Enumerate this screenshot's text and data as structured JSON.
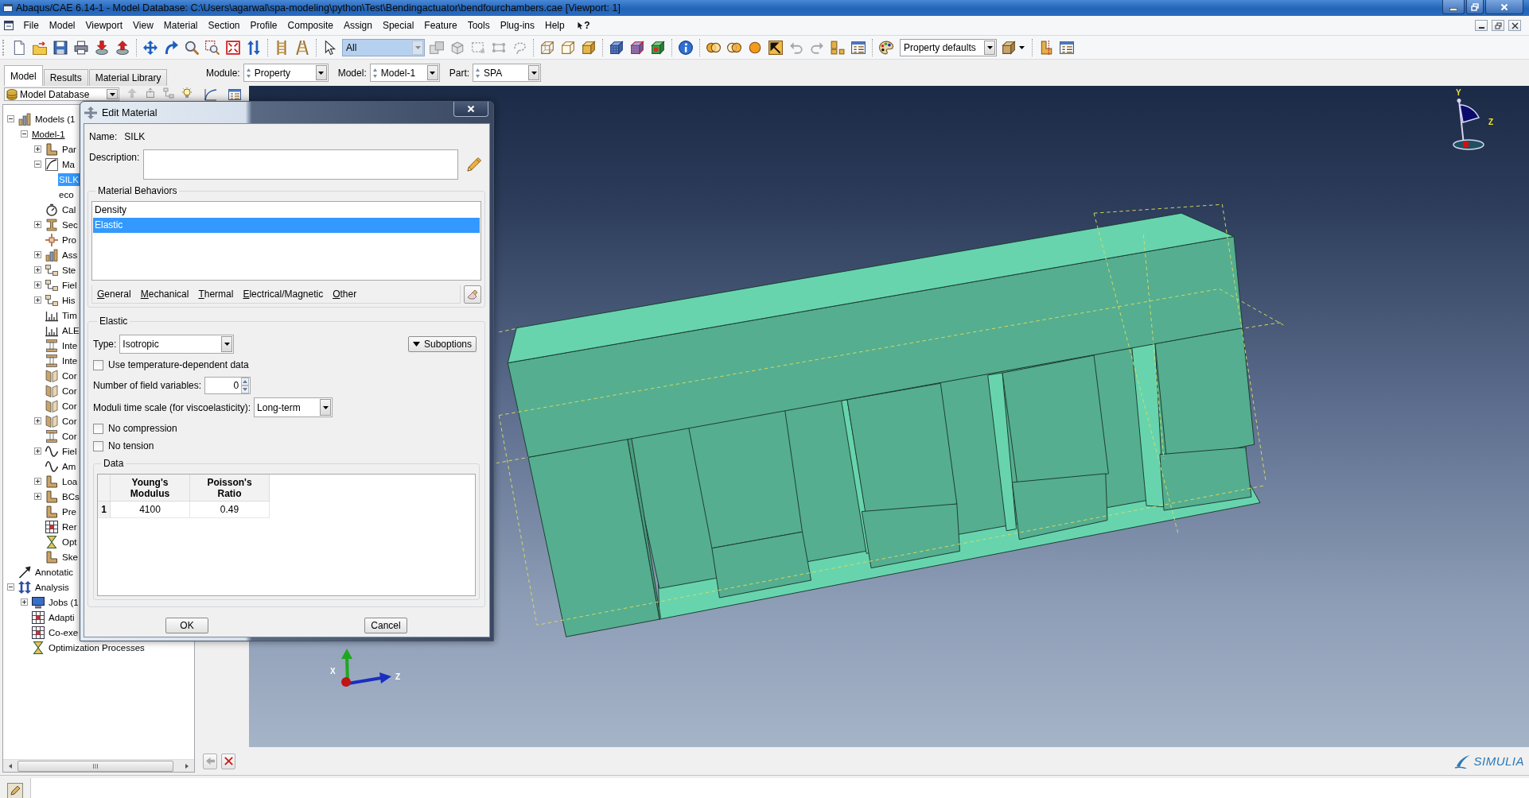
{
  "window": {
    "title": "Abaqus/CAE 6.14-1 - Model Database: C:\\Users\\agarwal\\spa-modeling\\python\\Test\\Bendingactuator\\bendfourchambers.cae [Viewport: 1]"
  },
  "menu_bar": {
    "items": [
      "File",
      "Model",
      "Viewport",
      "View",
      "Material",
      "Section",
      "Profile",
      "Composite",
      "Assign",
      "Special",
      "Feature",
      "Tools",
      "Plug-ins",
      "Help"
    ],
    "whats_this": "?"
  },
  "toolbar": {
    "selection_filter": "All",
    "color_code": "Property defaults"
  },
  "context_bar": [
    {
      "label": "Module:",
      "value": "Property"
    },
    {
      "label": "Model:",
      "value": "Model-1"
    },
    {
      "label": "Part:",
      "value": "SPA"
    }
  ],
  "model_tree": {
    "tabs": [
      {
        "label": "Model",
        "selected": true
      },
      {
        "label": "Results",
        "selected": false
      },
      {
        "label": "Material Library",
        "selected": false
      }
    ],
    "source": "Model Database",
    "items": [
      {
        "label": "Models (1",
        "kind": "models",
        "expanded": true,
        "selected": false,
        "children": [
          {
            "label": "Model-1",
            "expanded": true,
            "selected": false,
            "current": true,
            "children": [
              {
                "label": "Par",
                "kind": "parts",
                "expanded": false,
                "selected": false
              },
              {
                "label": "Ma",
                "kind": "materials",
                "expanded": true,
                "selected": false,
                "children": [
                  {
                    "label": "SILK",
                    "selected": true
                  },
                  {
                    "label": "eco",
                    "selected": false
                  }
                ]
              },
              {
                "label": "Cal",
                "kind": "calibrations",
                "selected": false
              },
              {
                "label": "Sec",
                "kind": "sections",
                "expanded": false,
                "selected": false
              },
              {
                "label": "Pro",
                "kind": "profiles",
                "selected": false
              },
              {
                "label": "Ass",
                "kind": "assembly",
                "expanded": false,
                "selected": false
              },
              {
                "label": "Ste",
                "kind": "steps",
                "expanded": false,
                "selected": false
              },
              {
                "label": "Fiel",
                "kind": "output",
                "expanded": false,
                "selected": false
              },
              {
                "label": "His",
                "kind": "output",
                "expanded": false,
                "selected": false
              },
              {
                "label": "Tim",
                "kind": "time",
                "selected": false
              },
              {
                "label": "ALE",
                "kind": "time",
                "selected": false
              },
              {
                "label": "Inte",
                "kind": "interaction",
                "selected": false
              },
              {
                "label": "Inte",
                "kind": "interaction",
                "selected": false
              },
              {
                "label": "Cor",
                "kind": "contact",
                "selected": false
              },
              {
                "label": "Cor",
                "kind": "contact",
                "selected": false
              },
              {
                "label": "Cor",
                "kind": "contact",
                "selected": false
              },
              {
                "label": "Cor",
                "kind": "contact",
                "expanded": false,
                "selected": false
              },
              {
                "label": "Cor",
                "kind": "interaction",
                "selected": false
              },
              {
                "label": "Fiel",
                "kind": "field",
                "expanded": false,
                "selected": false
              },
              {
                "label": "Am",
                "kind": "field",
                "selected": false
              },
              {
                "label": "Loa",
                "kind": "parts",
                "expanded": false,
                "selected": false
              },
              {
                "label": "BCs",
                "kind": "parts",
                "expanded": false,
                "selected": false
              },
              {
                "label": "Pre",
                "kind": "parts",
                "selected": false
              },
              {
                "label": "Rer",
                "kind": "remesh",
                "selected": false
              },
              {
                "label": "Opt",
                "kind": "optimization",
                "selected": false
              },
              {
                "label": "Ske",
                "kind": "parts",
                "selected": false
              }
            ]
          }
        ]
      },
      {
        "label": "Annotatic",
        "kind": "annotation",
        "selected": false
      },
      {
        "label": "Analysis",
        "kind": "analysis",
        "expanded": true,
        "selected": false,
        "children": [
          {
            "label": "Jobs (1",
            "kind": "jobs",
            "expanded": false,
            "selected": false
          },
          {
            "label": "Adapti",
            "kind": "remesh",
            "selected": false
          },
          {
            "label": "Co-exe",
            "kind": "remesh",
            "selected": false
          },
          {
            "label": "Optimization Processes",
            "kind": "optimization",
            "selected": false
          }
        ]
      }
    ]
  },
  "edit_material_dialog": {
    "title": "Edit Material",
    "name": {
      "label": "Name:",
      "value": "SILK"
    },
    "description": {
      "label": "Description:"
    },
    "behaviors": {
      "title": "Material Behaviors",
      "items": [
        {
          "label": "Density",
          "selected": false
        },
        {
          "label": "Elastic",
          "selected": true
        }
      ],
      "menus": [
        "General",
        "Mechanical",
        "Thermal",
        "Electrical/Magnetic",
        "Other"
      ]
    },
    "elastic": {
      "title": "Elastic",
      "type": {
        "label": "Type:",
        "value": "Isotropic"
      },
      "suboptions": "Suboptions",
      "options": [
        {
          "kind": "checkbox",
          "label": "Use temperature-dependent data",
          "checked": false
        },
        {
          "kind": "spinner",
          "label": "Number of field variables:",
          "value": "0"
        },
        {
          "kind": "dropdown",
          "label": "Moduli time scale (for viscoelasticity):",
          "value": "Long-term"
        },
        {
          "kind": "checkbox",
          "label": "No compression",
          "checked": false
        },
        {
          "kind": "checkbox",
          "label": "No tension",
          "checked": false
        }
      ],
      "data": {
        "title": "Data",
        "columns": [
          "Young's Modulus",
          "Poisson's Ratio"
        ],
        "rows": [
          {
            "index": "1",
            "cells": [
              "4100",
              "0.49"
            ]
          }
        ]
      }
    },
    "buttons": [
      "OK",
      "Cancel"
    ]
  },
  "viewport": {
    "orientation_labels": [
      "Y",
      "Z"
    ],
    "triad_labels": [
      "X",
      "Z"
    ]
  },
  "logo": "SIMULIA"
}
